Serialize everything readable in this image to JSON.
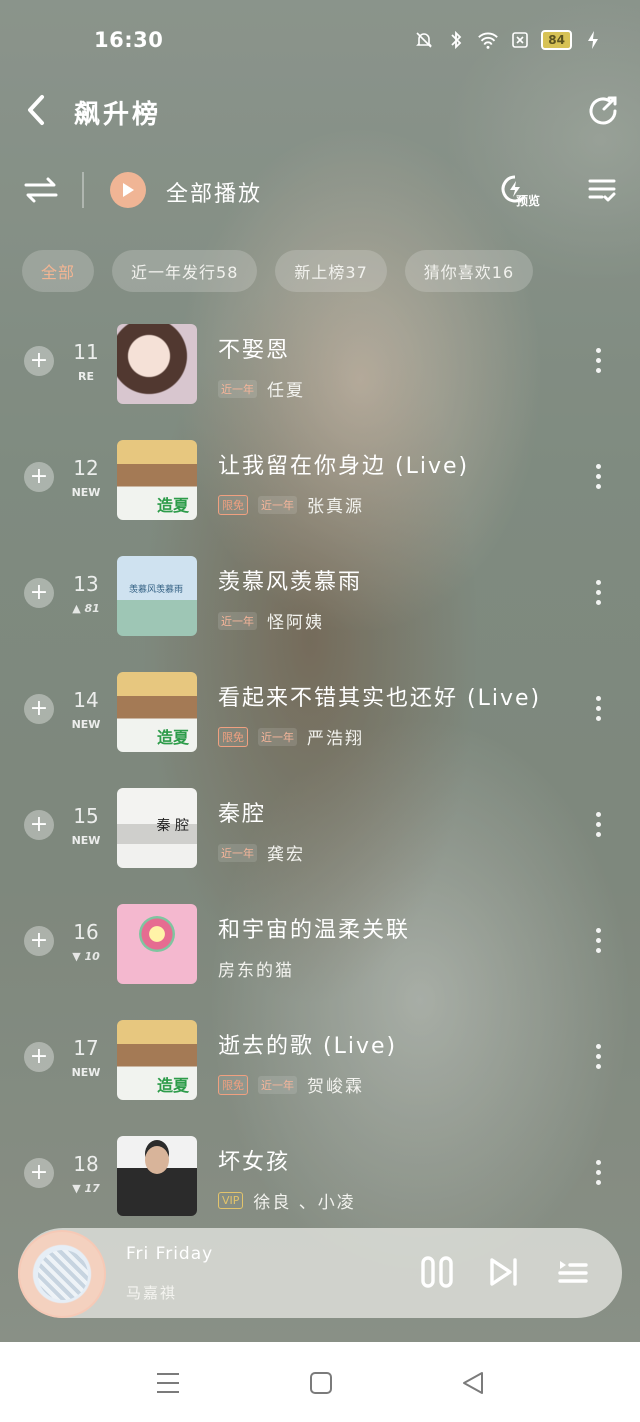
{
  "status_bar": {
    "time": "16:30",
    "battery": "84",
    "icons": [
      "bell-muted-icon",
      "bluetooth-icon",
      "wifi-icon",
      "sim-icon",
      "battery-icon",
      "charging-icon"
    ]
  },
  "header": {
    "title": "飙升榜"
  },
  "controls": {
    "play_all_label": "全部播放",
    "preview_label": "预览"
  },
  "chips": [
    {
      "label": "全部",
      "active": true
    },
    {
      "label": "近一年发行58",
      "active": false
    },
    {
      "label": "新上榜37",
      "active": false
    },
    {
      "label": "猜你喜欢16",
      "active": false
    }
  ],
  "songs": [
    {
      "rank": "11",
      "tag": "RE",
      "title": "不娶恩",
      "badges": [
        "近一年"
      ],
      "artist": "任夏",
      "cover": "girl"
    },
    {
      "rank": "12",
      "tag": "NEW",
      "title": "让我留在你身边 (Live)",
      "badges": [
        "限免",
        "近一年"
      ],
      "artist": "张真源",
      "cover": "group"
    },
    {
      "rank": "13",
      "tag": "▲ 81",
      "title": "羡慕风羡慕雨",
      "badges": [
        "近一年"
      ],
      "artist": "怪阿姨",
      "cover": "sky"
    },
    {
      "rank": "14",
      "tag": "NEW",
      "title": "看起来不错其实也还好 (Live)",
      "badges": [
        "限免",
        "近一年"
      ],
      "artist": "严浩翔",
      "cover": "group"
    },
    {
      "rank": "15",
      "tag": "NEW",
      "title": "秦腔",
      "badges": [
        "近一年"
      ],
      "artist": "龚宏",
      "cover": "ink"
    },
    {
      "rank": "16",
      "tag": "▼ 10",
      "title": "和宇宙的温柔关联",
      "badges": [],
      "artist": "房东的猫",
      "cover": "pink"
    },
    {
      "rank": "17",
      "tag": "NEW",
      "title": "逝去的歌 (Live)",
      "badges": [
        "限免",
        "近一年"
      ],
      "artist": "贺峻霖",
      "cover": "group"
    },
    {
      "rank": "18",
      "tag": "▼ 17",
      "title": "坏女孩",
      "badges": [
        "VIP"
      ],
      "artist": "徐良 、小凌",
      "cover": "man"
    }
  ],
  "cover_labels": {
    "group": "造夏",
    "sky": "羡慕风羡慕雨",
    "ink": "秦 腔"
  },
  "player": {
    "title": "Fri Friday",
    "artist": "马嘉祺"
  },
  "colors": {
    "accent": "#f0b595",
    "vip": "#e3c46c"
  }
}
